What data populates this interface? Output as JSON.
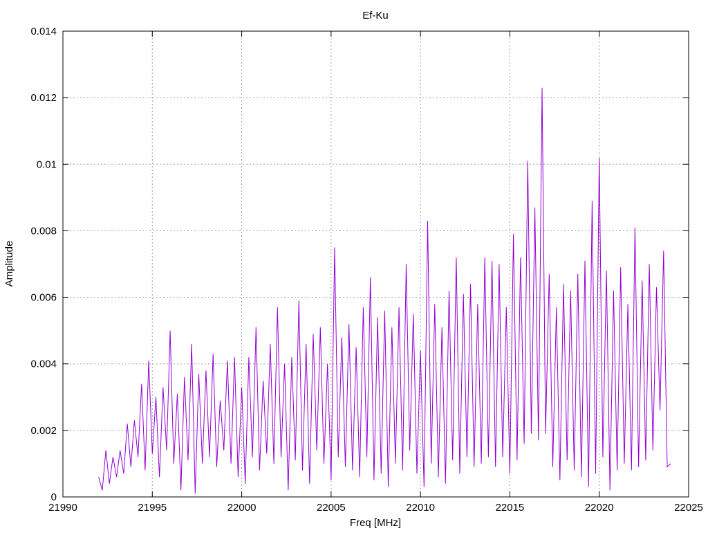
{
  "chart_data": {
    "type": "line",
    "title": "Ef-Ku",
    "xlabel": "Freq [MHz]",
    "ylabel": "Amplitude",
    "xlim": [
      21990,
      22025
    ],
    "ylim": [
      0,
      0.014
    ],
    "grid": true,
    "x_ticks": [
      "21990",
      "21995",
      "22000",
      "22005",
      "22010",
      "22015",
      "22020",
      "22025"
    ],
    "x_tick_values": [
      21990,
      21995,
      22000,
      22005,
      22010,
      22015,
      22020,
      22025
    ],
    "y_ticks": [
      "0",
      "0.002",
      "0.004",
      "0.006",
      "0.008",
      "0.01",
      "0.012",
      "0.014"
    ],
    "y_tick_values": [
      0,
      0.002,
      0.004,
      0.006,
      0.008,
      0.01,
      0.012,
      0.014
    ],
    "series": [
      {
        "name": "Ef-Ku",
        "color": "#9400d3",
        "x_start": 21992,
        "x_step": 0.2,
        "values": [
          0.0006,
          0.0002,
          0.0014,
          0.0004,
          0.0012,
          0.0006,
          0.0014,
          0.0007,
          0.0022,
          0.0009,
          0.0023,
          0.0012,
          0.0034,
          0.0008,
          0.0041,
          0.0013,
          0.003,
          0.0006,
          0.0033,
          0.0014,
          0.005,
          0.001,
          0.0031,
          0.0002,
          0.0036,
          0.0011,
          0.0046,
          0.0001,
          0.0037,
          0.001,
          0.0038,
          0.0012,
          0.0043,
          0.0009,
          0.0029,
          0.0014,
          0.0041,
          0.001,
          0.0042,
          0.0006,
          0.0033,
          0.0004,
          0.0042,
          0.0012,
          0.0051,
          0.0008,
          0.0035,
          0.0013,
          0.0046,
          0.001,
          0.0057,
          0.0012,
          0.004,
          0.0002,
          0.0042,
          0.0011,
          0.0059,
          0.0008,
          0.0046,
          0.0004,
          0.0049,
          0.0014,
          0.0051,
          0.001,
          0.004,
          0.0005,
          0.0075,
          0.0012,
          0.0048,
          0.0009,
          0.0052,
          0.0008,
          0.0045,
          0.0006,
          0.0057,
          0.0012,
          0.0066,
          0.0005,
          0.0054,
          0.0007,
          0.0056,
          0.0003,
          0.0051,
          0.001,
          0.0057,
          0.0008,
          0.007,
          0.0014,
          0.0055,
          0.0007,
          0.0044,
          0.0003,
          0.0083,
          0.001,
          0.0058,
          0.0006,
          0.0051,
          0.0004,
          0.0062,
          0.0011,
          0.0072,
          0.0007,
          0.0061,
          0.0012,
          0.0064,
          0.0009,
          0.0058,
          0.001,
          0.0072,
          0.0012,
          0.0071,
          0.0009,
          0.007,
          0.0012,
          0.0057,
          0.0007,
          0.0079,
          0.0011,
          0.0072,
          0.0016,
          0.0101,
          0.0019,
          0.0087,
          0.0017,
          0.0123,
          0.0019,
          0.0067,
          0.0009,
          0.0057,
          0.0005,
          0.0064,
          0.0011,
          0.0062,
          0.0008,
          0.0067,
          0.0006,
          0.0071,
          0.0003,
          0.0089,
          0.0007,
          0.0102,
          0.0012,
          0.0068,
          0.0002,
          0.0062,
          0.0008,
          0.0069,
          0.001,
          0.0058,
          0.0008,
          0.0081,
          0.0009,
          0.0065,
          0.0011,
          0.007,
          0.0014,
          0.0063,
          0.0026,
          0.0074,
          0.0009,
          0.001
        ]
      }
    ]
  }
}
